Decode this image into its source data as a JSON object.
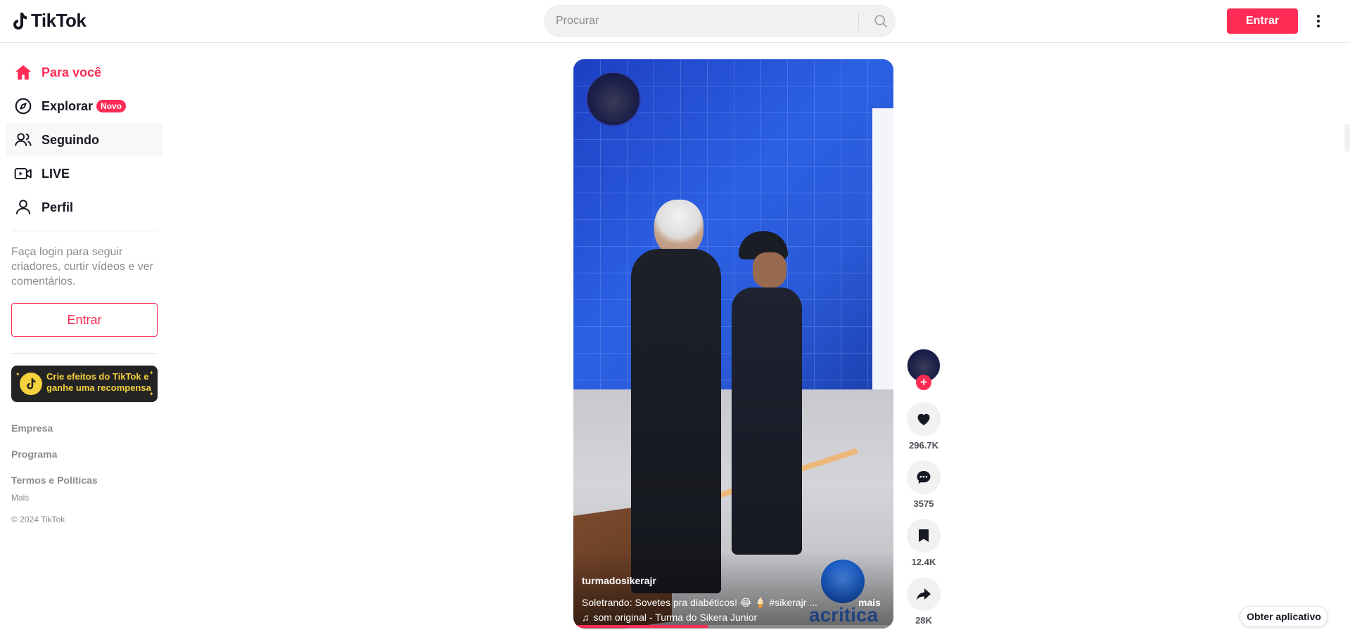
{
  "header": {
    "logo_text": "TikTok",
    "search_placeholder": "Procurar",
    "login_label": "Entrar"
  },
  "sidebar": {
    "items": [
      {
        "label": "Para você",
        "icon": "home-icon",
        "active": true
      },
      {
        "label": "Explorar",
        "icon": "compass-icon",
        "badge": "Novo"
      },
      {
        "label": "Seguindo",
        "icon": "users-icon"
      },
      {
        "label": "LIVE",
        "icon": "live-video-icon"
      },
      {
        "label": "Perfil",
        "icon": "person-icon"
      }
    ],
    "login_prompt": "Faça login para seguir criadores, curtir vídeos e ver comentários.",
    "login_button": "Entrar",
    "effects_banner": "Crie efeitos do TikTok e ganhe uma recompensa",
    "footer": {
      "company": "Empresa",
      "program": "Programa",
      "terms": "Termos e Políticas",
      "more": "Mais",
      "copyright": "© 2024 TikTok"
    }
  },
  "video": {
    "author": "turmadosikerajr",
    "description": "Soletrando: Sovetes pra diabéticos! 😂 🍦 #sikerajr ...",
    "more_label": "mais",
    "music": "som original - Turma do Sikera Junior",
    "watermark": "acritica",
    "progress": 0.42
  },
  "actions": {
    "likes": "296.7K",
    "comments": "3575",
    "saves": "12.4K",
    "shares": "28K"
  },
  "get_app_label": "Obter aplicativo",
  "colors": {
    "accent": "#fe2c55",
    "text": "#161823",
    "muted": "#8a8b91"
  }
}
